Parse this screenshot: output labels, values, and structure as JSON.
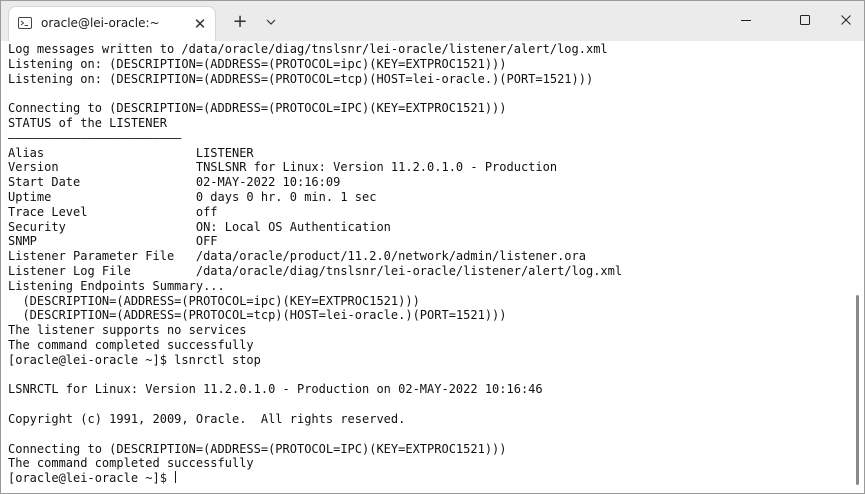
{
  "window": {
    "tab_title": "oracle@lei-oracle:~",
    "new_tab_label": "+",
    "tab_close_label": "✕"
  },
  "icons": {
    "tab": "terminal-icon",
    "new_tab": "plus-icon",
    "dropdown": "chevron-down-icon",
    "minimize": "minimize-icon",
    "maximize": "maximize-icon",
    "close": "close-icon"
  },
  "terminal": {
    "lines": [
      "Log messages written to /data/oracle/diag/tnslsnr/lei-oracle/listener/alert/log.xml",
      "Listening on: (DESCRIPTION=(ADDRESS=(PROTOCOL=ipc)(KEY=EXTPROC1521)))",
      "Listening on: (DESCRIPTION=(ADDRESS=(PROTOCOL=tcp)(HOST=lei-oracle.)(PORT=1521)))",
      "",
      "Connecting to (DESCRIPTION=(ADDRESS=(PROTOCOL=IPC)(KEY=EXTPROC1521)))",
      "STATUS of the LISTENER",
      "————————————————————————",
      "Alias                     LISTENER",
      "Version                   TNSLSNR for Linux: Version 11.2.0.1.0 - Production",
      "Start Date                02-MAY-2022 10:16:09",
      "Uptime                    0 days 0 hr. 0 min. 1 sec",
      "Trace Level               off",
      "Security                  ON: Local OS Authentication",
      "SNMP                      OFF",
      "Listener Parameter File   /data/oracle/product/11.2.0/network/admin/listener.ora",
      "Listener Log File         /data/oracle/diag/tnslsnr/lei-oracle/listener/alert/log.xml",
      "Listening Endpoints Summary...",
      "  (DESCRIPTION=(ADDRESS=(PROTOCOL=ipc)(KEY=EXTPROC1521)))",
      "  (DESCRIPTION=(ADDRESS=(PROTOCOL=tcp)(HOST=lei-oracle.)(PORT=1521)))",
      "The listener supports no services",
      "The command completed successfully",
      "[oracle@lei-oracle ~]$ lsnrctl stop",
      "",
      "LSNRCTL for Linux: Version 11.2.0.1.0 - Production on 02-MAY-2022 10:16:46",
      "",
      "Copyright (c) 1991, 2009, Oracle.  All rights reserved.",
      "",
      "Connecting to (DESCRIPTION=(ADDRESS=(PROTOCOL=IPC)(KEY=EXTPROC1521)))",
      "The command completed successfully",
      "[oracle@lei-oracle ~]$ "
    ]
  }
}
